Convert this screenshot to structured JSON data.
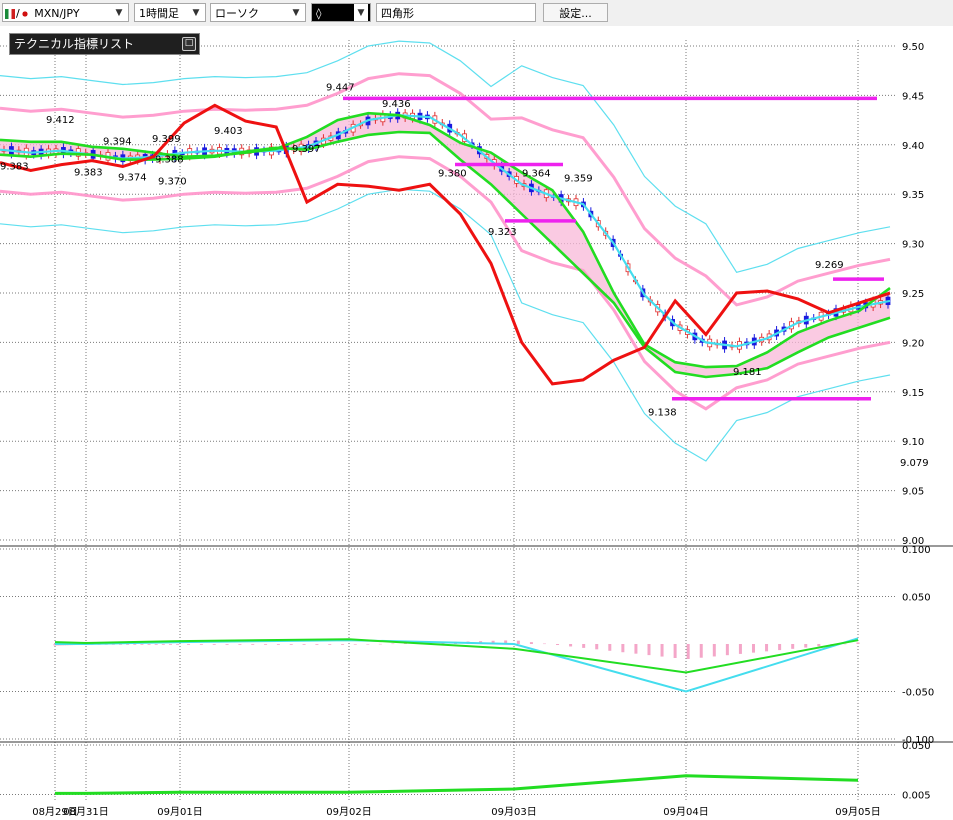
{
  "toolbar": {
    "symbol": "MXN/JPY",
    "flag_separator": "/",
    "timeframe": "1時間足",
    "chart_type": "ローソク",
    "draw_tool": "◊",
    "shape": "四角形",
    "settings_label": "設定..."
  },
  "indicator_panel": {
    "title": "テクニカル指標リスト",
    "minimize_glyph": "□"
  },
  "colors": {
    "up_candle": "#e03030",
    "down_candle": "#1a1adf",
    "sma_short": "#44ddee",
    "sma_long": "#22dd22",
    "bollinger_inner": "#ff99cc",
    "bollinger_outer": "#55ddee",
    "cloud_fill": "#f8b8d8",
    "sentiment_line": "#ee1111",
    "trend_lines": "#ee22ee"
  },
  "chart_data": [
    {
      "type": "candlestick",
      "title": "",
      "symbol": "MXN/JPY",
      "interval": "1時間足",
      "x_tick_labels": [
        "08月29日",
        "08月31日",
        "09月01日",
        "09月02日",
        "09月03日",
        "09月04日",
        "09月05日"
      ],
      "y_tick_labels": [
        "9.50",
        "9.45",
        "9.40",
        "9.35",
        "9.30",
        "9.25",
        "9.20",
        "9.15",
        "9.10",
        "9.05",
        "9.00"
      ],
      "ylim": [
        9.0,
        9.5
      ],
      "grid": true,
      "extra_axis_labels": [
        "9.079"
      ],
      "x_dates": [
        "08-29",
        "08-31",
        "09-01",
        "09-02",
        "09-03",
        "09-04",
        "09-05"
      ],
      "price_annotations": [
        {
          "text": "9.383",
          "x": "08-29",
          "value": 9.383
        },
        {
          "text": "9.412",
          "x": "08-30",
          "value": 9.412
        },
        {
          "text": "9.383",
          "x": "08-30",
          "value": 9.383
        },
        {
          "text": "9.394",
          "x": "08-31",
          "value": 9.394
        },
        {
          "text": "9.374",
          "x": "08-31",
          "value": 9.374
        },
        {
          "text": "9.399",
          "x": "08-31",
          "value": 9.399
        },
        {
          "text": "9.388",
          "x": "08-31",
          "value": 9.388
        },
        {
          "text": "9.370",
          "x": "08-31",
          "value": 9.37
        },
        {
          "text": "9.403",
          "x": "09-01",
          "value": 9.403
        },
        {
          "text": "9.397",
          "x": "09-02",
          "value": 9.397
        },
        {
          "text": "9.447",
          "x": "09-02",
          "value": 9.447
        },
        {
          "text": "9.436",
          "x": "09-02",
          "value": 9.436
        },
        {
          "text": "9.380",
          "x": "09-02",
          "value": 9.38
        },
        {
          "text": "9.323",
          "x": "09-03",
          "value": 9.323
        },
        {
          "text": "9.364",
          "x": "09-03",
          "value": 9.364
        },
        {
          "text": "9.359",
          "x": "09-03",
          "value": 9.359
        },
        {
          "text": "9.138",
          "x": "09-04",
          "value": 9.138
        },
        {
          "text": "9.181",
          "x": "09-04",
          "value": 9.181
        },
        {
          "text": "9.269",
          "x": "09-05",
          "value": 9.269
        }
      ],
      "horizontal_lines": [
        {
          "value": 9.447,
          "from": "09-02",
          "to": "09-05"
        },
        {
          "value": 9.38,
          "from": "09-02",
          "to": "09-03"
        },
        {
          "value": 9.323,
          "from": "09-03",
          "to": "09-03"
        },
        {
          "value": 9.143,
          "from": "09-04",
          "to": "09-05"
        },
        {
          "value": 9.264,
          "from": "09-05",
          "to": "09-05"
        }
      ],
      "series": [
        {
          "values": [
            9.395,
            9.392,
            9.394,
            9.39,
            9.386,
            9.388,
            9.392,
            9.394,
            9.393,
            9.394,
            9.398,
            9.41,
            9.425,
            9.43,
            9.428,
            9.41,
            9.384,
            9.36,
            9.348,
            9.34,
            9.3,
            9.248,
            9.218,
            9.2,
            9.196,
            9.204,
            9.22,
            9.228,
            9.236,
            9.242
          ]
        },
        {
          "values": [
            9.405,
            9.403,
            9.403,
            9.398,
            9.396,
            9.392,
            9.388,
            9.389,
            9.392,
            9.396,
            9.408,
            9.425,
            9.432,
            9.43,
            9.42,
            9.402,
            9.392,
            9.372,
            9.354,
            9.312,
            9.25,
            9.198,
            9.18,
            9.175,
            9.176,
            9.19,
            9.21,
            9.222,
            9.232,
            9.255
          ]
        },
        {
          "values": [
            9.39,
            9.388,
            9.391,
            9.39,
            9.385,
            9.385,
            9.386,
            9.388,
            9.393,
            9.397,
            9.395,
            9.403,
            9.41,
            9.413,
            9.412,
            9.385,
            9.36,
            9.33,
            9.3,
            9.27,
            9.24,
            9.195,
            9.17,
            9.165,
            9.168,
            9.174,
            9.19,
            9.205,
            9.215,
            9.225
          ]
        },
        {
          "values": [
            9.382,
            9.374,
            9.38,
            9.384,
            9.378,
            9.388,
            9.422,
            9.44,
            9.424,
            9.418,
            9.342,
            9.36,
            9.358,
            9.354,
            9.36,
            9.33,
            9.28,
            9.2,
            9.158,
            9.162,
            9.182,
            9.195,
            9.242,
            9.208,
            9.25,
            9.252,
            9.244,
            9.23,
            9.24,
            9.25
          ]
        }
      ]
    },
    {
      "type": "line",
      "title": "",
      "y_tick_labels": [
        "0.100",
        "0.050",
        "-0.050",
        "-0.100"
      ],
      "ylim": [
        -0.1,
        0.1
      ],
      "x": [
        "08-29",
        "08-31",
        "09-01",
        "09-02",
        "09-03",
        "09-04",
        "09-05"
      ],
      "series": [
        {
          "values": [
            0.0,
            0.0,
            0.002,
            0.004,
            0.0,
            -0.05,
            0.006
          ]
        },
        {
          "values": [
            0.002,
            0.001,
            0.003,
            0.005,
            -0.005,
            -0.03,
            0.004
          ]
        }
      ]
    },
    {
      "type": "line",
      "title": "",
      "y_tick_labels": [
        "0.050",
        "0.005"
      ],
      "ylim": [
        0.0,
        0.05
      ],
      "x": [
        "08-29",
        "08-31",
        "09-01",
        "09-02",
        "09-03",
        "09-04",
        "09-05"
      ],
      "series": [
        {
          "values": [
            0.006,
            0.006,
            0.007,
            0.007,
            0.01,
            0.022,
            0.018
          ]
        }
      ]
    }
  ]
}
